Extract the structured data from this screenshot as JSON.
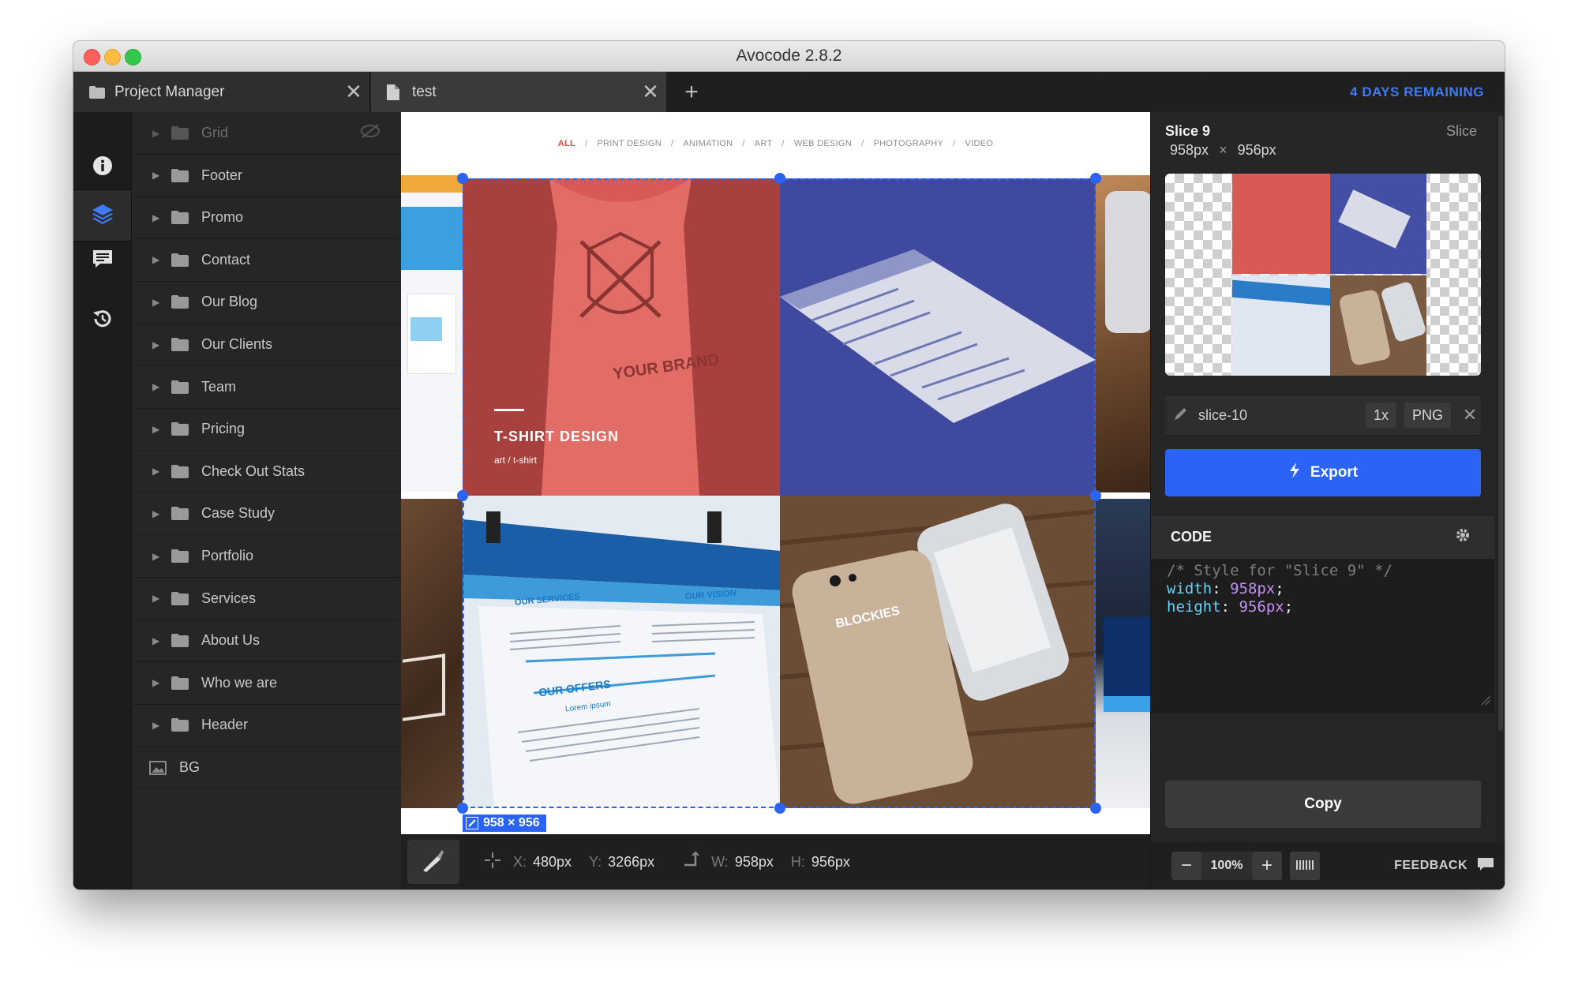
{
  "window": {
    "title": "Avocode 2.8.2"
  },
  "tabs": [
    {
      "label": "Project Manager",
      "icon": "folder-icon",
      "close": "✕"
    },
    {
      "label": "test",
      "icon": "document-icon",
      "close": "✕"
    }
  ],
  "tab_add": "+",
  "trial_notice": "4 DAYS REMAINING",
  "colors": {
    "accent": "#2a63f5",
    "trial": "#3e7bf5",
    "tile_red": "#d85a55",
    "tile_blue": "#434fa3"
  },
  "icon_sidebar": [
    {
      "icon": "info-icon",
      "active": false
    },
    {
      "icon": "layers-icon",
      "active": true
    },
    {
      "icon": "comments-icon",
      "active": false
    },
    {
      "icon": "history-icon",
      "active": false
    }
  ],
  "layers": [
    {
      "label": "Grid",
      "dim": true
    },
    {
      "label": "Footer"
    },
    {
      "label": "Promo"
    },
    {
      "label": "Contact"
    },
    {
      "label": "Our Blog"
    },
    {
      "label": "Our Clients"
    },
    {
      "label": "Team"
    },
    {
      "label": "Pricing"
    },
    {
      "label": "Check Out Stats"
    },
    {
      "label": "Case Study"
    },
    {
      "label": "Portfolio"
    },
    {
      "label": "Services"
    },
    {
      "label": "About Us"
    },
    {
      "label": "Who we are"
    },
    {
      "label": "Header"
    },
    {
      "label": "BG",
      "type": "image"
    }
  ],
  "design": {
    "nav": [
      "ALL",
      "PRINT DESIGN",
      "ANIMATION",
      "ART",
      "WEB DESIGN",
      "PHOTOGRAPHY",
      "VIDEO"
    ],
    "nav_separator": "/",
    "tshirt_title": "T-SHIRT DESIGN",
    "tshirt_sub": "art / t-shirt",
    "selection_size": "958 × 956",
    "tshirt_print": "YOUR BRAND",
    "phone_brand": "BLOCKIES",
    "flyer": {
      "services": "OUR SERVICES",
      "vision": "OUR VISION",
      "offers": "OUR OFFERS",
      "lorem": "Lorem ipsum"
    }
  },
  "measure": {
    "x_label": "X:",
    "x_val": "480px",
    "y_label": "Y:",
    "y_val": "3266px",
    "w_label": "W:",
    "w_val": "958px",
    "h_label": "H:",
    "h_val": "956px"
  },
  "inspector": {
    "name": "Slice 9",
    "type": "Slice",
    "width": "958px",
    "times": "×",
    "height": "956px",
    "export_name": "slice-10",
    "scale": "1x",
    "format": "PNG",
    "remove": "✕",
    "export_label": "Export",
    "code_title": "CODE",
    "code": {
      "comment": "/* Style for \"Slice 9\" */",
      "width_prop": "width",
      "width_val": "958px",
      "height_prop": "height",
      "height_val": "956px",
      "colon": ": ",
      "semicolon": ";"
    },
    "copy_label": "Copy",
    "zoom_minus": "−",
    "zoom": "100%",
    "zoom_plus": "+",
    "feedback": "FEEDBACK"
  }
}
